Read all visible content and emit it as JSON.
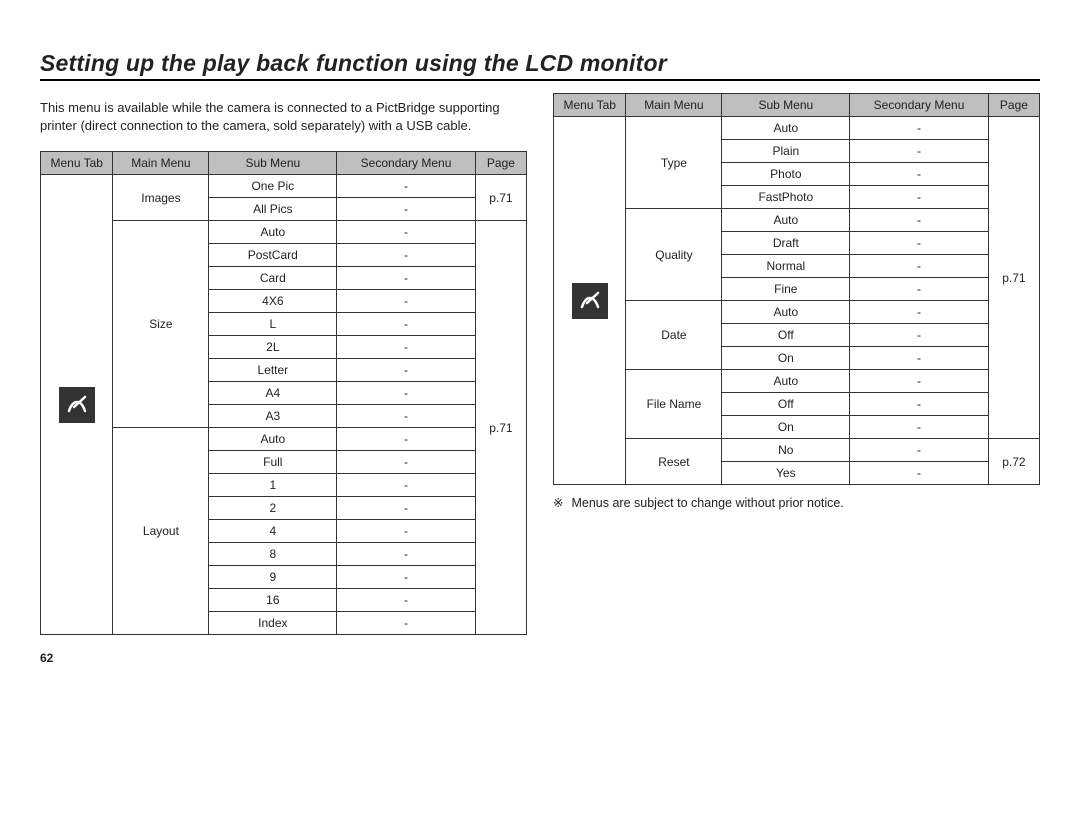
{
  "title": "Setting up the play back function using the LCD monitor",
  "intro": "This menu is available while the camera is connected to a PictBridge supporting printer (direct connection to the camera, sold separately) with a USB cable.",
  "headers": {
    "tab": "Menu Tab",
    "main": "Main Menu",
    "sub": "Sub Menu",
    "sec": "Secondary Menu",
    "page": "Page"
  },
  "table1": {
    "groups": [
      {
        "main": "Images",
        "page": "p.71",
        "rows": [
          {
            "sub": "One Pic",
            "sec": "-"
          },
          {
            "sub": "All Pics",
            "sec": "-"
          }
        ]
      },
      {
        "main": "Size",
        "page_group": true,
        "rows": [
          {
            "sub": "Auto",
            "sec": "-"
          },
          {
            "sub": "PostCard",
            "sec": "-"
          },
          {
            "sub": "Card",
            "sec": "-"
          },
          {
            "sub": "4X6",
            "sec": "-"
          },
          {
            "sub": "L",
            "sec": "-"
          },
          {
            "sub": "2L",
            "sec": "-"
          },
          {
            "sub": "Letter",
            "sec": "-"
          },
          {
            "sub": "A4",
            "sec": "-"
          },
          {
            "sub": "A3",
            "sec": "-"
          }
        ]
      },
      {
        "main": "Layout",
        "page_group": true,
        "rows": [
          {
            "sub": "Auto",
            "sec": "-"
          },
          {
            "sub": "Full",
            "sec": "-"
          },
          {
            "sub": "1",
            "sec": "-"
          },
          {
            "sub": "2",
            "sec": "-"
          },
          {
            "sub": "4",
            "sec": "-"
          },
          {
            "sub": "8",
            "sec": "-"
          },
          {
            "sub": "9",
            "sec": "-"
          },
          {
            "sub": "16",
            "sec": "-"
          },
          {
            "sub": "Index",
            "sec": "-"
          }
        ]
      }
    ],
    "shared_page": "p.71"
  },
  "table2": {
    "groups": [
      {
        "main": "Type",
        "rows": [
          {
            "sub": "Auto",
            "sec": "-"
          },
          {
            "sub": "Plain",
            "sec": "-"
          },
          {
            "sub": "Photo",
            "sec": "-"
          },
          {
            "sub": "FastPhoto",
            "sec": "-"
          }
        ]
      },
      {
        "main": "Quality",
        "rows": [
          {
            "sub": "Auto",
            "sec": "-"
          },
          {
            "sub": "Draft",
            "sec": "-"
          },
          {
            "sub": "Normal",
            "sec": "-"
          },
          {
            "sub": "Fine",
            "sec": "-"
          }
        ]
      },
      {
        "main": "Date",
        "rows": [
          {
            "sub": "Auto",
            "sec": "-"
          },
          {
            "sub": "Off",
            "sec": "-"
          },
          {
            "sub": "On",
            "sec": "-"
          }
        ]
      },
      {
        "main": "File Name",
        "rows": [
          {
            "sub": "Auto",
            "sec": "-"
          },
          {
            "sub": "Off",
            "sec": "-"
          },
          {
            "sub": "On",
            "sec": "-"
          }
        ]
      },
      {
        "main": "Reset",
        "page": "p.72",
        "rows": [
          {
            "sub": "No",
            "sec": "-"
          },
          {
            "sub": "Yes",
            "sec": "-"
          }
        ]
      }
    ],
    "shared_page": "p.71"
  },
  "note_symbol": "※",
  "note_text": "Menus are subject to change without prior notice.",
  "page_number": "62",
  "icon_name": "pictbridge-icon"
}
